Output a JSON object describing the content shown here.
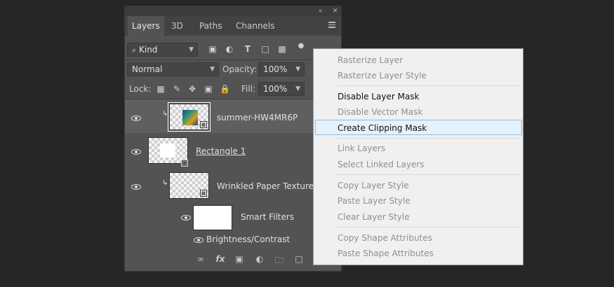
{
  "panel": {
    "topbar": {
      "collapse": "«",
      "close": "✕"
    },
    "tabs": [
      {
        "label": "Layers"
      },
      {
        "label": "3D"
      },
      {
        "label": "Paths"
      },
      {
        "label": "Channels"
      }
    ],
    "filter": {
      "label": "Kind",
      "icons": [
        "image-filter-icon",
        "adjustment-filter-icon",
        "type-filter-icon",
        "shape-filter-icon",
        "smart-object-filter-icon"
      ]
    },
    "blend_mode": "Normal",
    "opacity": {
      "label": "Opacity:",
      "value": "100%"
    },
    "lock": {
      "label": "Lock:"
    },
    "fill": {
      "label": "Fill:",
      "value": "100%"
    },
    "layers": [
      {
        "name": "summer-HW4MR6P"
      },
      {
        "name": "Rectangle 1"
      },
      {
        "name": "Wrinkled Paper Texture"
      },
      {
        "name": "Smart Filters"
      },
      {
        "name": "Brightness/Contrast"
      }
    ]
  },
  "context_menu": {
    "items": [
      {
        "label": "Rasterize Layer",
        "enabled": false
      },
      {
        "label": "Rasterize Layer Style",
        "enabled": false
      },
      {
        "label": "Disable Layer Mask",
        "enabled": true
      },
      {
        "label": "Disable Vector Mask",
        "enabled": false
      },
      {
        "label": "Create Clipping Mask",
        "enabled": true,
        "highlighted": true
      },
      {
        "label": "Link Layers",
        "enabled": false
      },
      {
        "label": "Select Linked Layers",
        "enabled": false
      },
      {
        "label": "Copy Layer Style",
        "enabled": false
      },
      {
        "label": "Paste Layer Style",
        "enabled": false
      },
      {
        "label": "Clear Layer Style",
        "enabled": false
      },
      {
        "label": "Copy Shape Attributes",
        "enabled": false
      },
      {
        "label": "Paste Shape Attributes",
        "enabled": false
      }
    ]
  }
}
